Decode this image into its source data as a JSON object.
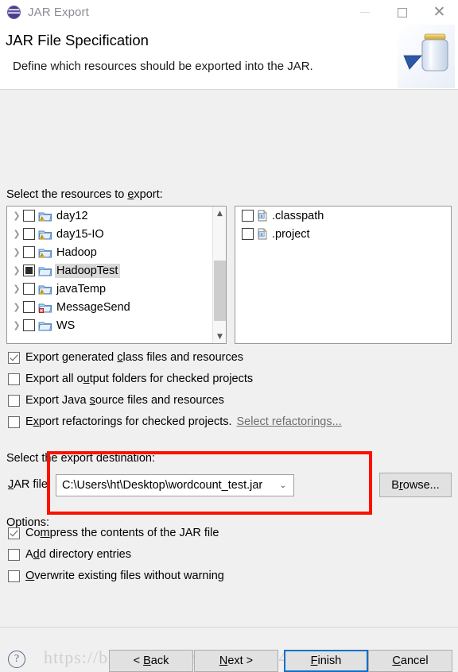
{
  "window": {
    "title": "JAR Export",
    "icon": "eclipse-icon",
    "minimize_label": "—",
    "maximize_label": "□",
    "close_label": "✕"
  },
  "header": {
    "title": "JAR File Specification",
    "subtitle": "Define which resources should be exported into the JAR.",
    "art_icon": "jar-export-banner-icon"
  },
  "resources": {
    "label_before": "Select the resources to ",
    "label_mnemonic": "e",
    "label_after": "xport:",
    "left_tree": [
      {
        "name": "day12",
        "state": "unchecked",
        "icon": "project-folder-warning-icon",
        "selected": false
      },
      {
        "name": "day15-IO",
        "state": "unchecked",
        "icon": "project-folder-warning-icon",
        "selected": false
      },
      {
        "name": "Hadoop",
        "state": "unchecked",
        "icon": "project-folder-warning-icon",
        "selected": false
      },
      {
        "name": "HadoopTest",
        "state": "grayed",
        "icon": "project-folder-icon",
        "selected": true
      },
      {
        "name": "javaTemp",
        "state": "unchecked",
        "icon": "project-folder-warning-icon",
        "selected": false
      },
      {
        "name": "MessageSend",
        "state": "unchecked",
        "icon": "project-folder-error-icon",
        "selected": false
      },
      {
        "name": "WS",
        "state": "unchecked",
        "icon": "project-folder-icon",
        "selected": false
      }
    ],
    "right_tree": [
      {
        "name": ".classpath",
        "state": "unchecked",
        "icon": "xml-file-icon"
      },
      {
        "name": ".project",
        "state": "unchecked",
        "icon": "xml-file-icon"
      }
    ],
    "scrollbar": {
      "up_glyph": "▲",
      "down_glyph": "▼"
    }
  },
  "export_options": [
    {
      "checked": true,
      "pre": "Export generated ",
      "mnemonic": "c",
      "post": "lass files and resources"
    },
    {
      "checked": false,
      "pre": "Export all o",
      "mnemonic": "u",
      "post": "tput folders for checked projects"
    },
    {
      "checked": false,
      "pre": "Export Java ",
      "mnemonic": "s",
      "post": "ource files and resources"
    },
    {
      "checked": false,
      "pre": "E",
      "mnemonic": "x",
      "post": "port refactorings for checked projects.",
      "link": "Select refactorings..."
    }
  ],
  "destination": {
    "section_label": "Select the export destination:",
    "jar_file_pre": "",
    "jar_file_mnemonic": "J",
    "jar_file_post": "AR file:",
    "jar_file_value": "C:\\Users\\ht\\Desktop\\wordcount_test.jar",
    "combo_arrow": "⌄",
    "browse_pre": "B",
    "browse_mnemonic": "r",
    "browse_post": "owse...",
    "highlight_color": "#fb1100"
  },
  "options_section": {
    "label": "Options:",
    "items": [
      {
        "checked": true,
        "pre": "Co",
        "mnemonic": "m",
        "post": "press the contents of the JAR file"
      },
      {
        "checked": false,
        "pre": "A",
        "mnemonic": "d",
        "post": "d directory entries"
      },
      {
        "checked": false,
        "pre": "",
        "mnemonic": "O",
        "post": "verwrite existing files without warning"
      }
    ]
  },
  "footer": {
    "help_label": "?",
    "buttons": [
      {
        "id": "back",
        "pre": "< ",
        "mnemonic": "B",
        "post": "ack",
        "default": false,
        "enabled": true
      },
      {
        "id": "next",
        "pre": "",
        "mnemonic": "N",
        "post": "ext >",
        "default": false,
        "enabled": true
      },
      {
        "id": "finish",
        "pre": "",
        "mnemonic": "F",
        "post": "inish",
        "default": true,
        "enabled": true
      },
      {
        "id": "cancel",
        "pre": "",
        "mnemonic": "C",
        "post": "ancel",
        "default": false,
        "enabled": true
      }
    ],
    "watermark": "https://blog.csdn.net/A22063349612"
  }
}
